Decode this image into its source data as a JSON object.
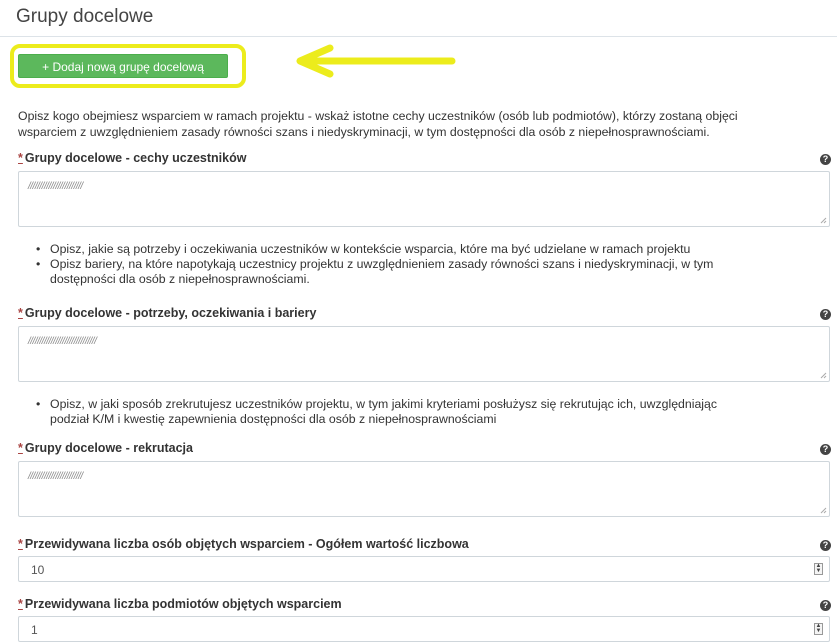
{
  "page": {
    "title": "Grupy docelowe"
  },
  "toolbar": {
    "add_button_icon": "plus-icon",
    "add_button_label": "+ Dodaj nową grupę docelową",
    "highlight_color": "#ecec1c",
    "button_color": "#5cb85c"
  },
  "description": {
    "line1": "Opisz kogo obejmiesz wsparciem w ramach projektu - wskaż istotne cechy uczestników (osób lub podmiotów), którzy zostaną objęci",
    "line2": "wsparciem z uwzględnieniem zasady równości szans i niedyskryminacji, w tym dostępności dla osób z niepełnosprawnościami."
  },
  "fields": {
    "cechy": {
      "required_mark": "*",
      "label": "Grupy docelowe - cechy uczestników",
      "value": "////////////////////////"
    },
    "potrzeby": {
      "required_mark": "*",
      "label": "Grupy docelowe - potrzeby, oczekiwania i bariery",
      "value": "//////////////////////////////"
    },
    "rekrutacja": {
      "required_mark": "*",
      "label": "Grupy docelowe - rekrutacja",
      "value": "////////////////////////"
    },
    "liczba_osob": {
      "required_mark": "*",
      "label": "Przewidywana liczba osób objętych wsparciem - Ogółem wartość liczbowa",
      "value": "10"
    },
    "liczba_podmiotow": {
      "required_mark": "*",
      "label": "Przewidywana liczba podmiotów objętych wsparciem",
      "value": "1"
    }
  },
  "hints": {
    "potrzeby": [
      "Opisz, jakie są potrzeby i oczekiwania uczestników w kontekście wsparcia, które ma być udzielane w ramach projektu",
      "Opisz bariery, na które napotykają uczestnicy projektu z uwzględnieniem zasady równości szans i niedyskryminacji, w tym",
      "dostępności dla osób z niepełnosprawnościami."
    ],
    "rekrutacja": [
      "Opisz, w jaki sposób zrekrutujesz uczestników projektu, w tym jakimi kryteriami posłużysz się rekrutując ich, uwzględniając",
      "podział K/M i kwestię zapewnienia dostępności dla osób z niepełnosprawnościami"
    ]
  },
  "icons": {
    "help": "question-circle-icon",
    "arrow": "arrow-left-icon",
    "resize": "resize-grip-icon",
    "spinner": "number-spinner-icon"
  }
}
